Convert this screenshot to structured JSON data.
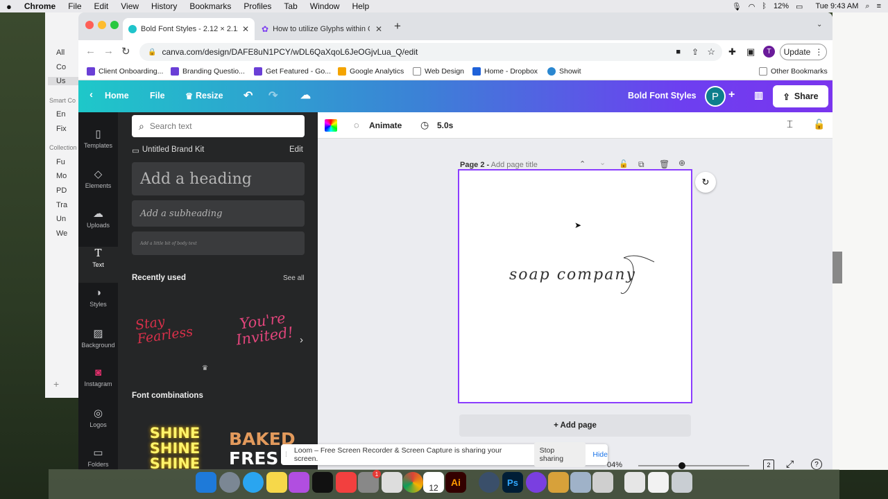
{
  "menubar": {
    "app": "Chrome",
    "items": [
      "File",
      "Edit",
      "View",
      "History",
      "Bookmarks",
      "Profiles",
      "Tab",
      "Window",
      "Help"
    ],
    "battery": "12%",
    "clock": "Tue 9:43 AM"
  },
  "finder": {
    "rows_top": [
      "All",
      "Co",
      "Us"
    ],
    "header_smart": "Smart Co",
    "rows_smart": [
      "En",
      "Fix"
    ],
    "header_collections": "Collection",
    "rows_collections": [
      "Fu",
      "Mo",
      "PD",
      "Tra",
      "Un",
      "We"
    ]
  },
  "browser": {
    "tabs": [
      {
        "title": "Bold Font Styles - 2.12 × 2.12in"
      },
      {
        "title": "How to utilize Glyphs within Ca"
      }
    ],
    "url": "canva.com/design/DAFE8uN1PCY/wDL6QaXqoL6JeOGjvLua_Q/edit",
    "update_label": "Update",
    "profile_initial": "T",
    "bookmarks": [
      {
        "label": "Client Onboarding...",
        "color": "#6a3fd6"
      },
      {
        "label": "Branding Questio...",
        "color": "#6a3fd6"
      },
      {
        "label": "Get Featured - Go...",
        "color": "#6a3fd6"
      },
      {
        "label": "Google Analytics",
        "color": "#f4a400"
      },
      {
        "label": "Web Design",
        "color": "#888888"
      },
      {
        "label": "Home - Dropbox",
        "color": "#1f62d9"
      },
      {
        "label": "Showit",
        "color": "#2a87d0"
      }
    ],
    "other_bookmarks": "Other Bookmarks"
  },
  "canva_header": {
    "home": "Home",
    "file": "File",
    "resize": "Resize",
    "design_title": "Bold Font Styles",
    "avatar": "P",
    "share": "Share"
  },
  "rail": [
    {
      "label": "Templates",
      "icon": "templates-icon",
      "glyph": "▯"
    },
    {
      "label": "Elements",
      "icon": "elements-icon",
      "glyph": "◇"
    },
    {
      "label": "Uploads",
      "icon": "uploads-icon",
      "glyph": "☁"
    },
    {
      "label": "Text",
      "icon": "text-icon",
      "glyph": "T"
    },
    {
      "label": "Styles",
      "icon": "styles-icon",
      "glyph": "◑"
    },
    {
      "label": "Background",
      "icon": "background-icon",
      "glyph": "▨"
    },
    {
      "label": "Instagram",
      "icon": "instagram-icon",
      "glyph": "◙"
    },
    {
      "label": "Logos",
      "icon": "logos-icon",
      "glyph": "◎"
    },
    {
      "label": "Folders",
      "icon": "folders-icon",
      "glyph": "▭"
    }
  ],
  "panel": {
    "search_placeholder": "Search text",
    "brand_kit": "Untitled Brand Kit",
    "edit": "Edit",
    "add_heading": "Add a heading",
    "add_subheading": "Add a subheading",
    "add_body": "Add a little bit of body text",
    "recently_used": "Recently used",
    "see_all": "See all",
    "recent1": "Stay Fearless",
    "recent2": "You're Invited!",
    "font_combinations": "Font combinations",
    "combo1": "SHINE",
    "combo2a": "BAKED",
    "combo2b": "FRES"
  },
  "editor": {
    "animate": "Animate",
    "duration": "5.0s",
    "page_label": "Page 2 -",
    "page_title_placeholder": "Add page title",
    "canvas_text": "soap company",
    "add_page": "+ Add page",
    "zoom": "04%",
    "page_count": "2"
  },
  "loom": {
    "message": "Loom – Free Screen Recorder & Screen Capture is sharing your screen.",
    "stop": "Stop sharing",
    "hide": "Hide"
  },
  "dock": {
    "calendar_day": "12",
    "mail_badge": "1"
  }
}
